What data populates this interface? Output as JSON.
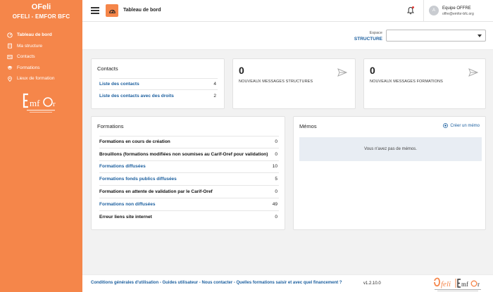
{
  "sidebar": {
    "app_title": "OFeli",
    "app_subtitle": "OFELI - EMFOR BFC",
    "items": [
      {
        "label": "Tableau de bord",
        "icon": "dashboard-icon"
      },
      {
        "label": "Ma structure",
        "icon": "building-icon"
      },
      {
        "label": "Contacts",
        "icon": "contact-card-icon"
      },
      {
        "label": "Formations",
        "icon": "graduation-cap-icon"
      },
      {
        "label": "Lieux de formation",
        "icon": "location-pin-icon"
      }
    ],
    "logo_icon": "emfor-logo"
  },
  "topbar": {
    "title": "Tableau de bord",
    "user_name": "Equipe OFFRE",
    "user_email": "offre@emfor-bfc.org",
    "avatar_initial": "A"
  },
  "espace": {
    "label": "Espace",
    "value": "STRUCTURE"
  },
  "contacts": {
    "title": "Contacts",
    "rows": [
      {
        "label": "Liste des contacts",
        "count": "4"
      },
      {
        "label": "Liste des contacts avec des droits",
        "count": "2"
      }
    ]
  },
  "messages_structures": {
    "count": "0",
    "label": "NOUVEAUX MESSAGES STRUCTURES"
  },
  "messages_formations": {
    "count": "0",
    "label": "NOUVEAUX MESSAGES FORMATIONS"
  },
  "formations": {
    "title": "Formations",
    "rows": [
      {
        "label": "Formations en cours de création",
        "count": "0"
      },
      {
        "label": "Brouillons (formations modifiées non soumises au Carif-Oref pour validation)",
        "count": "0"
      },
      {
        "label": "Formations diffusées",
        "count": "10"
      },
      {
        "label": "Formations fonds publics diffusées",
        "count": "5"
      },
      {
        "label": "Formations en attente de validation par le Carif-Oref",
        "count": "0"
      },
      {
        "label": "Formations non diffusées",
        "count": "49"
      },
      {
        "label": "Erreur liens site internet",
        "count": "0"
      }
    ]
  },
  "memos": {
    "title": "Mémos",
    "create_label": "Créer un mémo",
    "empty_text": "Vous n'avez pas de mémos."
  },
  "footer": {
    "links": [
      "Conditions générales d'utilisation",
      "Guides utilisateur",
      "Nous contacter",
      "Quelles formations saisir et avec quel financement ?"
    ],
    "version": "v1.2.10.0"
  },
  "colors": {
    "brand_orange": "#f5864a",
    "link_blue": "#1a5e9e"
  }
}
